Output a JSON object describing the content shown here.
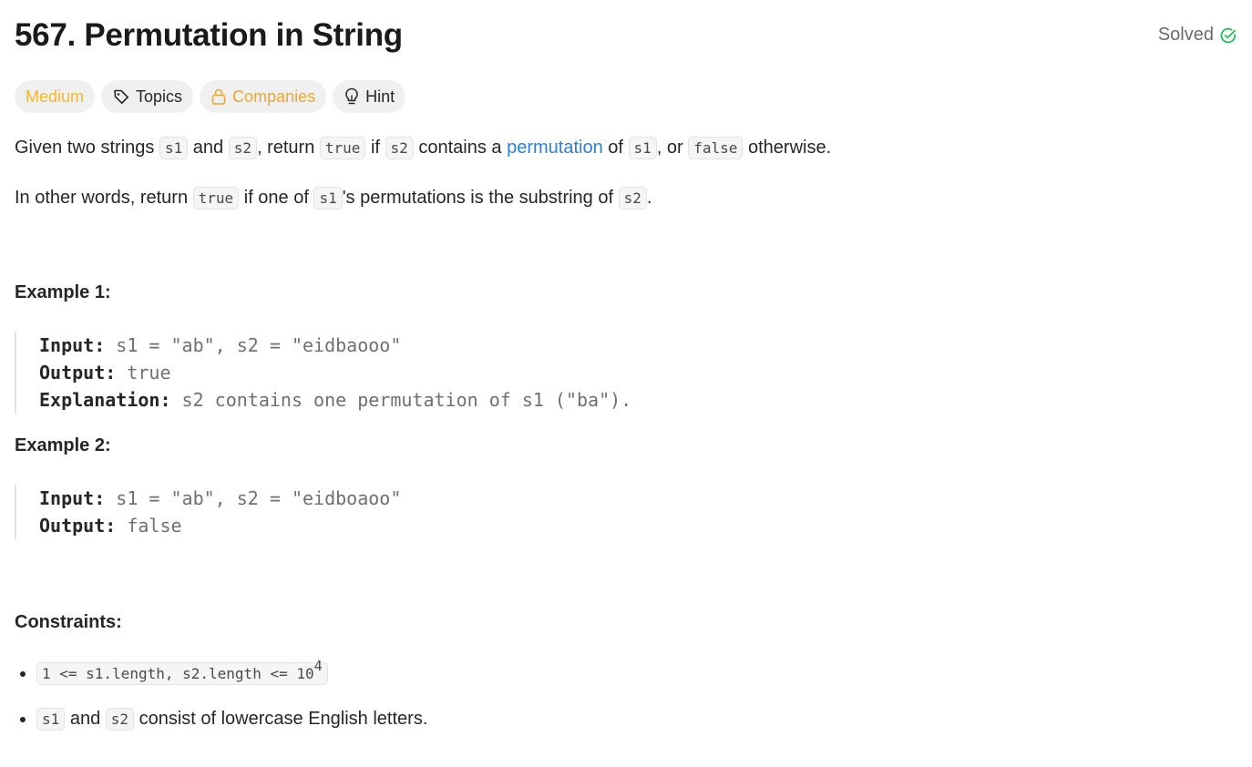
{
  "problem": {
    "title": "567. Permutation in String",
    "status": "Solved"
  },
  "tags": {
    "difficulty": "Medium",
    "topics": "Topics",
    "companies": "Companies",
    "hint": "Hint"
  },
  "description": {
    "p1": {
      "t1": "Given two strings ",
      "c1": "s1",
      "t2": " and ",
      "c2": "s2",
      "t3": ", return ",
      "c3": "true",
      "t4": " if ",
      "c4": "s2",
      "t5": " contains a ",
      "link": "permutation",
      "t6": " of ",
      "c5": "s1",
      "t7": ", or ",
      "c6": "false",
      "t8": " otherwise."
    },
    "p2": {
      "t1": "In other words, return ",
      "c1": "true",
      "t2": " if one of ",
      "c2": "s1",
      "t3": "'s permutations is the substring of ",
      "c3": "s2",
      "t4": "."
    }
  },
  "examples": [
    {
      "title": "Example 1:",
      "input_label": "Input:",
      "input": " s1 = \"ab\", s2 = \"eidbaooo\"",
      "output_label": "Output:",
      "output": " true",
      "explanation_label": "Explanation:",
      "explanation": " s2 contains one permutation of s1 (\"ba\")."
    },
    {
      "title": "Example 2:",
      "input_label": "Input:",
      "input": " s1 = \"ab\", s2 = \"eidboaoo\"",
      "output_label": "Output:",
      "output": " false"
    }
  ],
  "constraints": {
    "title": "Constraints:",
    "c1_code": "1 <= s1.length, s2.length <= 10",
    "c1_sup": "4",
    "c2": {
      "c1": "s1",
      "t1": " and ",
      "c2": "s2",
      "t2": " consist of lowercase English letters."
    }
  },
  "colors": {
    "medium": "#f5b731",
    "companies": "#e8a836",
    "link": "#2f7fd8",
    "solved_check": "#2cbb5d"
  },
  "icons": {
    "solved": "check-circle-icon",
    "topics": "tag-icon",
    "companies": "lock-icon",
    "hint": "lightbulb-icon"
  }
}
